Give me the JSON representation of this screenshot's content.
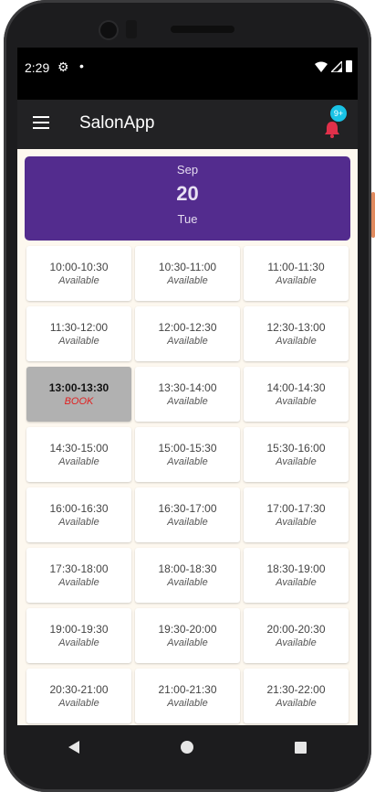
{
  "status_bar": {
    "time": "2:29",
    "gear_icon": "⚙",
    "dot": "•"
  },
  "app_bar": {
    "title": "SalonApp",
    "notification_count": "9+"
  },
  "date_card": {
    "month": "Sep",
    "day": "20",
    "weekday": "Tue"
  },
  "slots": [
    {
      "time": "10:00-10:30",
      "status": "Available",
      "booked": false
    },
    {
      "time": "10:30-11:00",
      "status": "Available",
      "booked": false
    },
    {
      "time": "11:00-11:30",
      "status": "Available",
      "booked": false
    },
    {
      "time": "11:30-12:00",
      "status": "Available",
      "booked": false
    },
    {
      "time": "12:00-12:30",
      "status": "Available",
      "booked": false
    },
    {
      "time": "12:30-13:00",
      "status": "Available",
      "booked": false
    },
    {
      "time": "13:00-13:30",
      "status": "BOOK",
      "booked": true
    },
    {
      "time": "13:30-14:00",
      "status": "Available",
      "booked": false
    },
    {
      "time": "14:00-14:30",
      "status": "Available",
      "booked": false
    },
    {
      "time": "14:30-15:00",
      "status": "Available",
      "booked": false
    },
    {
      "time": "15:00-15:30",
      "status": "Available",
      "booked": false
    },
    {
      "time": "15:30-16:00",
      "status": "Available",
      "booked": false
    },
    {
      "time": "16:00-16:30",
      "status": "Available",
      "booked": false
    },
    {
      "time": "16:30-17:00",
      "status": "Available",
      "booked": false
    },
    {
      "time": "17:00-17:30",
      "status": "Available",
      "booked": false
    },
    {
      "time": "17:30-18:00",
      "status": "Available",
      "booked": false
    },
    {
      "time": "18:00-18:30",
      "status": "Available",
      "booked": false
    },
    {
      "time": "18:30-19:00",
      "status": "Available",
      "booked": false
    },
    {
      "time": "19:00-19:30",
      "status": "Available",
      "booked": false
    },
    {
      "time": "19:30-20:00",
      "status": "Available",
      "booked": false
    },
    {
      "time": "20:00-20:30",
      "status": "Available",
      "booked": false
    },
    {
      "time": "20:30-21:00",
      "status": "Available",
      "booked": false
    },
    {
      "time": "21:00-21:30",
      "status": "Available",
      "booked": false
    },
    {
      "time": "21:30-22:00",
      "status": "Available",
      "booked": false
    }
  ],
  "colors": {
    "date_card_bg": "#532c8e",
    "booked_slot_bg": "#b1b1b1",
    "booked_status_text": "#e02020",
    "badge_bg": "#19c3e6",
    "bell": "#e0304a",
    "app_bar_bg": "#222224",
    "content_bg": "#fdf8ef"
  },
  "icons": {
    "menu": "menu-icon",
    "bell": "bell-icon",
    "wifi": "wifi-icon",
    "signal": "signal-icon",
    "battery": "battery-icon",
    "nav_back": "back-icon",
    "nav_home": "home-icon",
    "nav_recent": "recents-icon"
  }
}
